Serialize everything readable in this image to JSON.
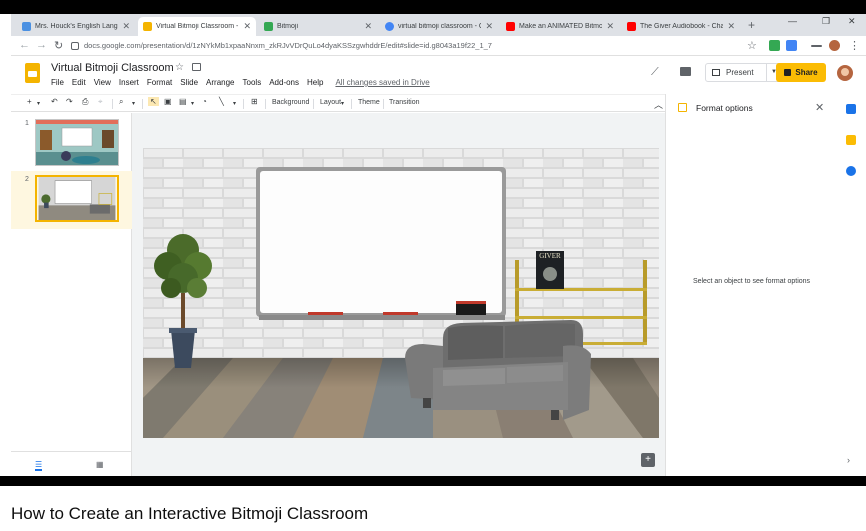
{
  "browser": {
    "tabs": [
      {
        "title": "Mrs. Houck's English Langua",
        "favicon_color": "#4a90e2"
      },
      {
        "title": "Virtual Bitmoji Classroom - G",
        "favicon_color": "#f4b400"
      },
      {
        "title": "Bitmoji",
        "favicon_color": "#34a853"
      },
      {
        "title": "virtual bitmoji classroom - G",
        "favicon_color": "#4285f4"
      },
      {
        "title": "Make an ANIMATED Bitmoji",
        "favicon_color": "#ff0000"
      },
      {
        "title": "The Giver Audiobook - Chap",
        "favicon_color": "#ff0000"
      }
    ],
    "url": "docs.google.com/presentation/d/1zNYkMb1xpaaNnxm_zkRJvVDrQuLo4dyaKSSzgwhddrE/edit#slide=id.g8043a19f22_1_7"
  },
  "app": {
    "title": "Virtual Bitmoji Classroom",
    "menu": [
      "File",
      "Edit",
      "View",
      "Insert",
      "Format",
      "Slide",
      "Arrange",
      "Tools",
      "Add-ons",
      "Help"
    ],
    "saved_status": "All changes saved in Drive",
    "present_label": "Present",
    "share_label": "Share"
  },
  "toolbar": {
    "background_label": "Background",
    "layout_label": "Layout",
    "theme_label": "Theme",
    "transition_label": "Transition"
  },
  "filmstrip": {
    "slides": [
      {
        "number": "1",
        "selected": false
      },
      {
        "number": "2",
        "selected": true
      }
    ]
  },
  "slide": {
    "book_title": "GIVER"
  },
  "format_panel": {
    "title": "Format options",
    "hint": "Select an object to see format options"
  },
  "colors": {
    "accent": "#f4b400",
    "share": "#fbbc04",
    "link": "#1a73e8"
  },
  "video": {
    "title": "How to Create an Interactive Bitmoji Classroom"
  }
}
